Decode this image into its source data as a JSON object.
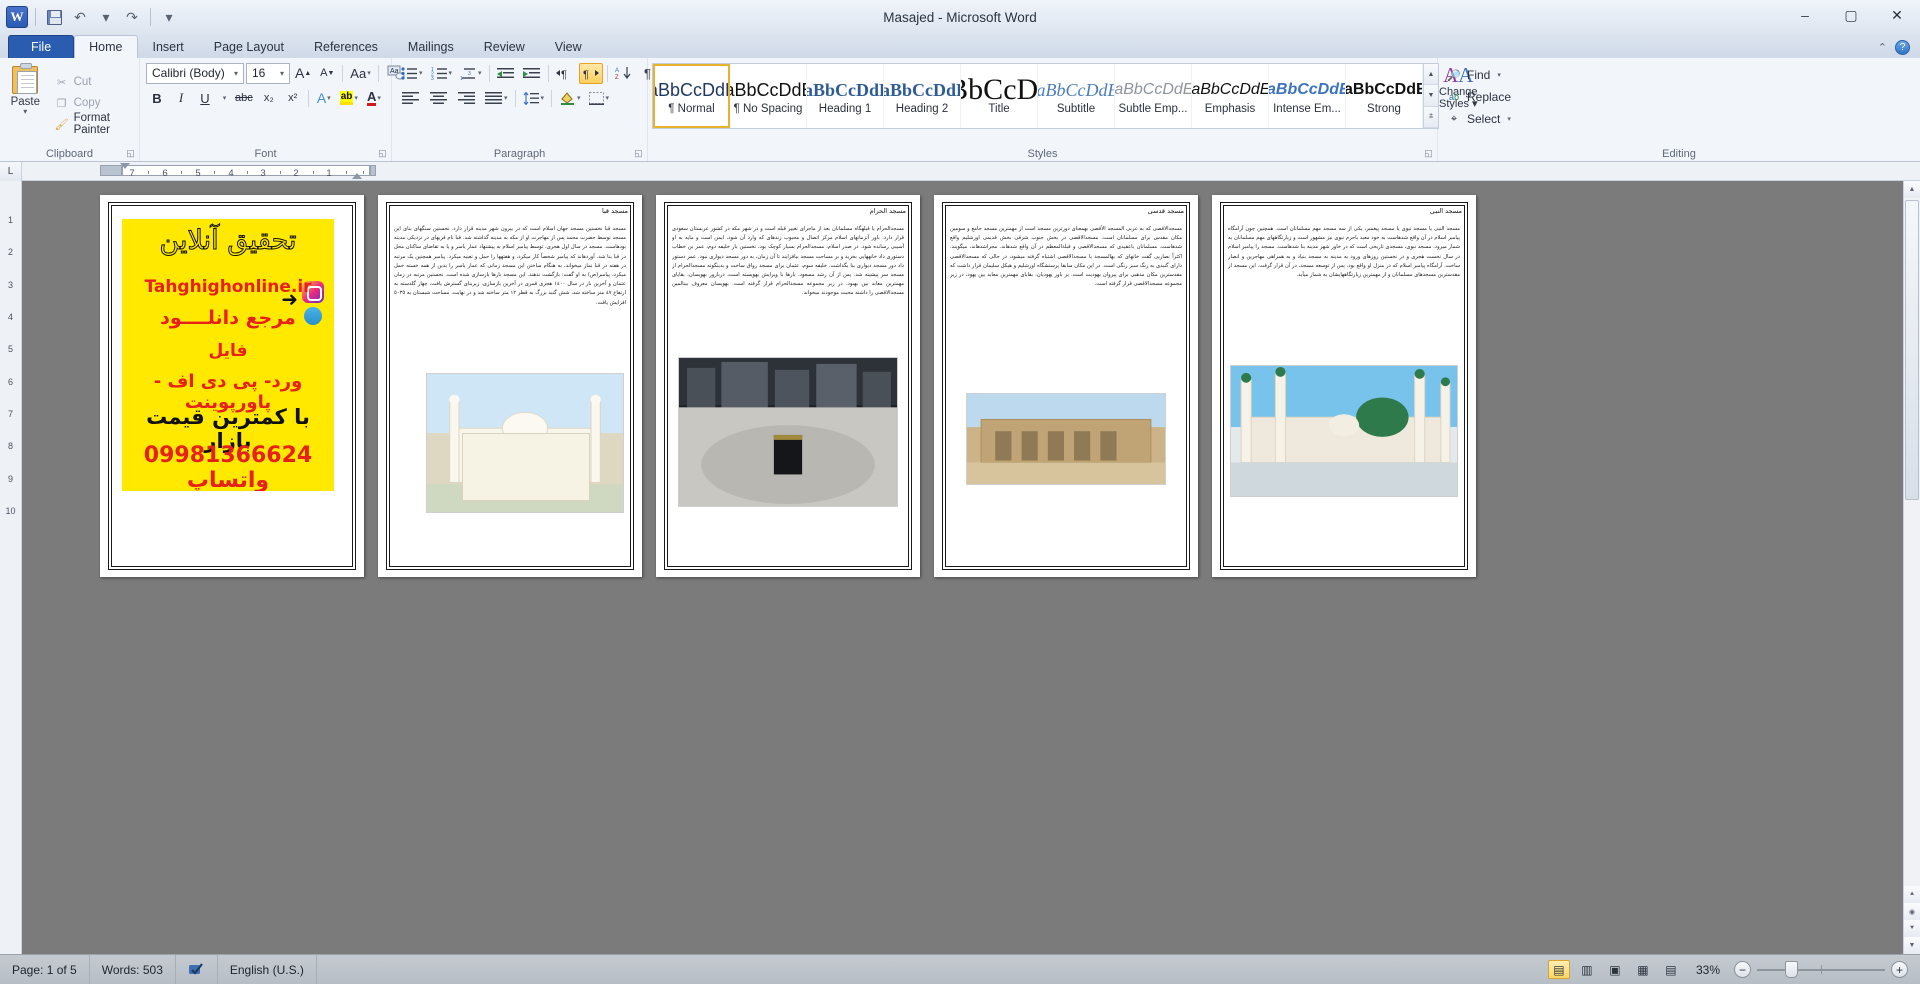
{
  "window": {
    "title": "Masajed  -  Microsoft Word",
    "app_icon": "word-icon",
    "minimize": "–",
    "maximize": "▢",
    "close": "✕"
  },
  "quick_access": {
    "save": "save-icon",
    "undo": "undo-icon",
    "undo_caret": "▾",
    "redo": "redo-icon",
    "customize": "▾"
  },
  "tabs": [
    {
      "label": "File",
      "active": false,
      "file": true
    },
    {
      "label": "Home",
      "active": true
    },
    {
      "label": "Insert",
      "active": false
    },
    {
      "label": "Page Layout",
      "active": false
    },
    {
      "label": "References",
      "active": false
    },
    {
      "label": "Mailings",
      "active": false
    },
    {
      "label": "Review",
      "active": false
    },
    {
      "label": "View",
      "active": false
    }
  ],
  "ribbon": {
    "clipboard": {
      "group_name": "Clipboard",
      "paste_label": "Paste",
      "paste_caret": "▾",
      "items": [
        {
          "label": "Cut",
          "icon": "scissors-icon",
          "glyph": "✄"
        },
        {
          "label": "Copy",
          "icon": "copy-icon",
          "glyph": "❏"
        },
        {
          "label": "Format Painter",
          "icon": "paintbrush-icon",
          "glyph": "🖌"
        }
      ]
    },
    "font": {
      "group_name": "Font",
      "font_family": "Calibri (Body)",
      "font_size": "16",
      "grow_font": "A",
      "shrink_font": "A",
      "change_case": "Aa",
      "clear_formatting": "Aa",
      "bold": "B",
      "italic": "I",
      "underline": "U",
      "strikethrough": "abc",
      "subscript": "x₂",
      "superscript": "x²",
      "text_effects": "A",
      "highlight": "ab",
      "font_color": "A",
      "caret": "▾"
    },
    "paragraph": {
      "group_name": "Paragraph",
      "bullets": "bullets-icon",
      "numbering": "numbering-icon",
      "multilevel": "multilevel-list-icon",
      "decrease_indent": "decrease-indent-icon",
      "increase_indent": "increase-indent-icon",
      "ltr_text": "ltr-icon",
      "rtl_text": "rtl-icon",
      "sort": "sort-icon",
      "show_marks": "¶",
      "align_left": "align-left-icon",
      "align_center": "align-center-icon",
      "align_right": "align-right-icon",
      "justify": "justify-icon",
      "line_spacing": "line-spacing-icon",
      "shading": "shading-icon",
      "borders": "borders-icon"
    },
    "styles": {
      "group_name": "Styles",
      "items": [
        {
          "preview": "AaBbCcDdEe",
          "name": "¶ Normal",
          "selected": true
        },
        {
          "preview": "AaBbCcDdEe",
          "name": "¶ No Spacing",
          "selected": false
        },
        {
          "preview": "AaBbCcDdEe",
          "name": "Heading 1",
          "selected": false
        },
        {
          "preview": "AaBbCcDdEe",
          "name": "Heading 2",
          "selected": false
        },
        {
          "preview": "AaBbCcDdEe",
          "name": "Title",
          "selected": false
        },
        {
          "preview": "AaBbCcDdEe",
          "name": "Subtitle",
          "selected": false
        },
        {
          "preview": "AaBbCcDdEe",
          "name": "Subtle Emp...",
          "selected": false
        },
        {
          "preview": "AaBbCcDdEe",
          "name": "Emphasis",
          "selected": false
        },
        {
          "preview": "AaBbCcDdEe",
          "name": "Intense Em...",
          "selected": false
        },
        {
          "preview": "AaBbCcDdEe",
          "name": "Strong",
          "selected": false
        }
      ],
      "change_styles_line1": "Change",
      "change_styles_line2": "Styles ▾",
      "scroll_up": "▲",
      "scroll_down": "▼",
      "more": "▼"
    },
    "editing": {
      "group_name": "Editing",
      "items": [
        {
          "label": "Find",
          "icon": "binoculars-icon",
          "glyph": "🔍",
          "caret": "▾"
        },
        {
          "label": "Replace",
          "icon": "replace-icon",
          "glyph": "ab",
          "caret": ""
        },
        {
          "label": "Select",
          "icon": "cursor-icon",
          "glyph": "▹",
          "caret": "▾"
        }
      ]
    },
    "help": {
      "collapse_ribbon": "⌃",
      "help": "?"
    }
  },
  "ruler": {
    "corner_marker": "L",
    "ticks": [
      "7",
      "6",
      "5",
      "4",
      "3",
      "2",
      "1"
    ],
    "vertical_ticks": [
      "1",
      "2",
      "3",
      "4",
      "5",
      "6",
      "7",
      "8",
      "9",
      "10"
    ]
  },
  "document": {
    "pages": [
      {
        "heading": "",
        "has_ad": true,
        "ad": {
          "line1": "تحقیق آنلاین",
          "line2": "Tahghighonline.ir",
          "line3": "مرجع دانلــــود",
          "line4": "فایل",
          "line5": "ورد- پی دی اف - پاورپوینت",
          "line6": "با کمترین قیمت بازار",
          "line7": "09981366624 واتساپ",
          "instagram": "instagram-icon",
          "telegram": "telegram-icon",
          "arrow": "➜"
        }
      },
      {
        "heading": "مسجد قبا",
        "body": "مسجد قبا نخستین مسجد جهان اسلام است که در بیرون شهر مدینه قرار دارد. نخستین سنگهای بنای این مسجد توسط حضرت محمد پس از مهاجرت او از مکه به مدینه گذاشته شد. قبا نام قریهای در نزدیکی مدینه بودهاست. مسجد در سال اول هجری، توسط پیامبر اسلام به پیشنهاد عمار یاسر و یا به تقاضای ساکنان محل در قبا بنا شد. آوردهاند که پیامبر شخصاً کار میکرد، و هفتهها را حمل و تعبیه میکرد. پیامبر همچنین یک مرتبه در هفته در قبا نماز میخواند، به هنگام ساختن این مسجد زمانی که عمار یاسر را بدین از همه خسته حمل میکرد، پیامبر(ص) به او گفت: بازگشت ندهند. این مسجد بارها بازسازی شده است. نخستین مرتبه در زمان عثمان و آخرین بار در سال ۱٤۰۰ هجری قمری در آخرین بازسازی، زیربنای گسترش یافت، چهار گلدسته به ارتفاع ٤۷ متر ساخته شد، شش گنبد بزرگ به قطر ۱۲ متر ساخته شد و در نهایت، مساحت شبستان به ٥٠٣٥ افزایش یافت.",
        "image": "mosque-quba-image"
      },
      {
        "heading": "مسجد الحرام",
        "body": "مسجدالحرام یا قبلهگاه مسلمانان بعد از ماجرای تغییر قبله است و در شهر مکه در کشور عربستان سعودی قرار دارد. باور آنزمانهای اسلام مرکز اتصال و محبوب زندهای که وارد آن شود، ایمن است و مایه به او آسیبی رسانده شود. در صدر اسلام، مسجدالحرام بسیار کوچک بود، نخستین بار خلیفه دوم، عمر بن خطاب دستوری داد خانههایی بخرید و بر مساحت مسجد بیافزایند تا آن زمان، به دور مسجد دیواری نبود. عمر دستور داد دور مسجد دیواری بنا بگذاشت. خلیفه سوم، عثمان برای مسجد رواق ساخت و بدینگونه مسجدالحرام از مسجد سر پیشینه شد. پس از آن رشد مسعود، بارها با ویرایش بهویسته است، دربارور بهویسان، بقایای مهمترین معابد بین بهبود، در زیر مجموعه مسجدالحرام قرار گرفته است. بهویسان معروف بینالمین مسجدالاقصی را داشته محبت موجودند میخواند.",
        "image": "mosque-haram-image"
      },
      {
        "heading": "مسجد قدسی",
        "body": "مسجدالاقصی که به عربی المسجد الأقصی بهمعنای دورترین مسجد است از مهمترین مسجد جامع و سومین مکان مقدس برای مسلمانان است. مسجدالاقصی در بخش جنوب شرقی بخش قدیمی اورشلیم واقع شدهاست. مسلمانان باعقیدی که مسجدالاقصی و قبلةالمعظم در آن واقع شدهاند. مجراشدهاند، میگویند. اکثراً نصاریی گفت خانهای که بهالمسجد با مسجدالاقصی اشتباه گرفته میشود، در حالی که مسجدالاقصی دارای گنبدی به رنگ سبز رنگی است. در این مکان سابقا پرستشگاه اورشلیم و هیکل سلیمان قرار داشت که مقدسترین مکان مذهبی برای پیروان یهودیت است. بر باور یهودیان، بقایای مهمترین معابد بین یهود، در زیر مجموعه مسجدالاقصی قرار گرفته است.",
        "image": "mosque-aqsa-image"
      },
      {
        "heading": "مسجد النبی",
        "body": "مسجد النبی یا مسجد نبوی یا مسجد پیغمبر، یکی از سه مسجد مهم مسلمانان است. همچنین چون آرامگاه پیامبر اسلام در آن واقع شدهاست به خود معبد باحرم نبوی نیز مشهور است و زیارتگاههای مهم مسلمانان به شمار میرود. مسجد نبوی، مسجدی تاریخی است که در خاور شهر مدینه بنا شدهاست. مسجد را پیامبر اسلام در سال نخست هجری و در نخستین روزهای ورود به مدینه به مسجد بنیاد و به همراهی مهاجرین و انصار ساخت. آرامگاه پیامبر اسلام که در منزل او واقع بود، پس از توسعه مسجد، در آن قرار گرفت. این مسجد از مقدسترین مسجدهای مسلمانان و از مهمترین زیارتگاههایشان به شمار میآید.",
        "image": "mosque-nabawi-image"
      }
    ]
  },
  "status_bar": {
    "page": "Page: 1 of 5",
    "words": "Words: 503",
    "proofing_icon": "spell-check-icon",
    "language": "English (U.S.)",
    "views": [
      {
        "name": "print-layout",
        "glyph": "▤",
        "selected": true
      },
      {
        "name": "full-screen-reading",
        "glyph": "▥",
        "selected": false
      },
      {
        "name": "web-layout",
        "glyph": "▣",
        "selected": false
      },
      {
        "name": "outline",
        "glyph": "▦",
        "selected": false
      },
      {
        "name": "draft",
        "glyph": "▤",
        "selected": false
      }
    ],
    "zoom": "33%",
    "zoom_out": "−",
    "zoom_in": "+"
  },
  "colors": {
    "accent": "#2a5db0",
    "ribbon_bg": "#f2f5fa",
    "highlight_yellow": "#ffe900",
    "ad_red": "#e8201a",
    "link_blue": "#1f4fd8"
  }
}
